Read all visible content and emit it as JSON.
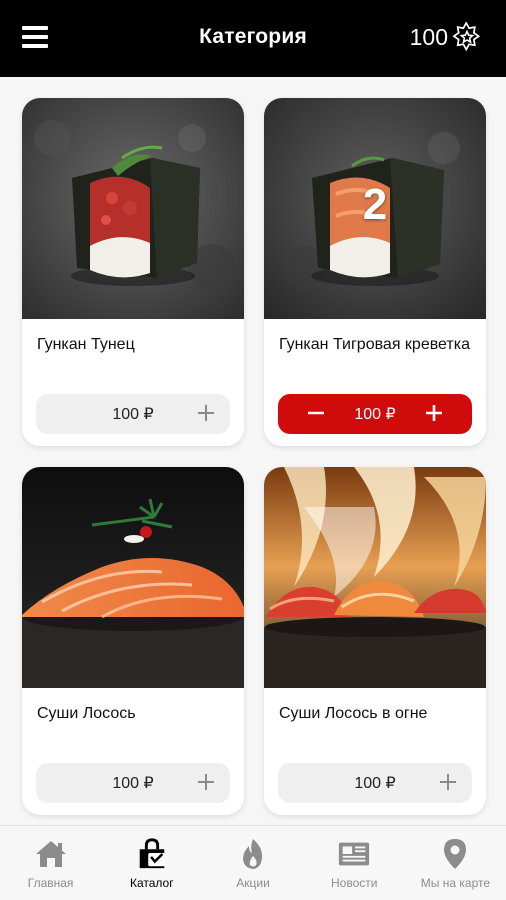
{
  "header": {
    "title": "Категория",
    "points": "100"
  },
  "products": [
    {
      "name": "Гункан Тунец",
      "price": "100 ₽",
      "quantity": null
    },
    {
      "name": "Гункан Тигровая креветка",
      "price": "100 ₽",
      "quantity": "2"
    },
    {
      "name": "Суши Лосось",
      "price": "100 ₽",
      "quantity": null
    },
    {
      "name": "Суши Лосось в огне",
      "price": "100 ₽",
      "quantity": null
    }
  ],
  "nav": {
    "items": [
      {
        "label": "Главная",
        "icon": "home-icon",
        "active": false
      },
      {
        "label": "Каталог",
        "icon": "shopping-bag-icon",
        "active": true
      },
      {
        "label": "Акции",
        "icon": "flame-icon",
        "active": false
      },
      {
        "label": "Новости",
        "icon": "newspaper-icon",
        "active": false
      },
      {
        "label": "Мы на карте",
        "icon": "map-pin-icon",
        "active": false
      }
    ]
  },
  "colors": {
    "accent": "#cf0b0b",
    "header_bg": "#000000",
    "nav_inactive": "#8c8c8c"
  }
}
